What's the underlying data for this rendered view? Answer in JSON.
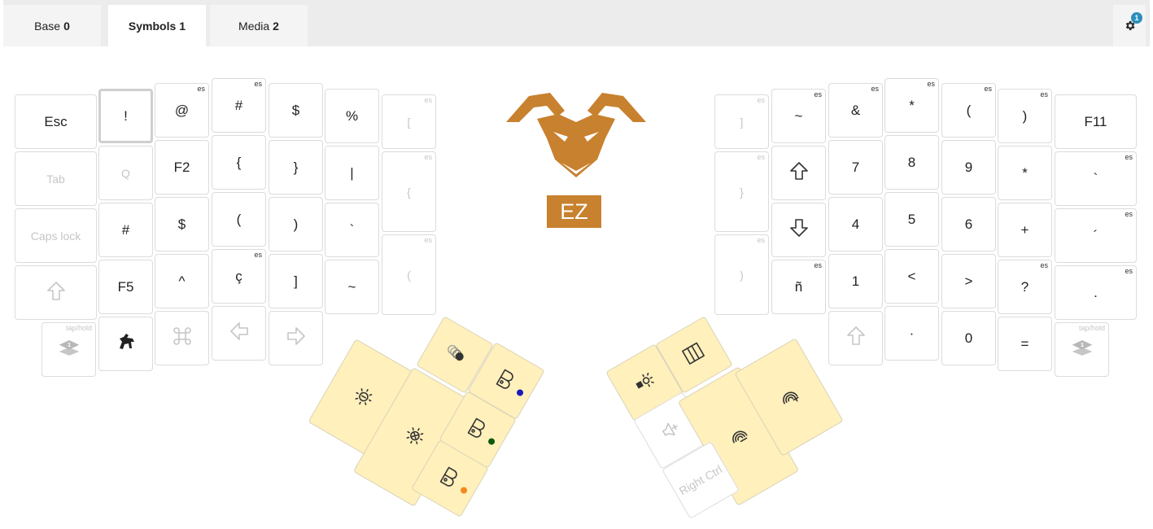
{
  "tabs": [
    {
      "label": "Base",
      "num": "0"
    },
    {
      "label": "Symbols",
      "num": "1"
    },
    {
      "label": "Media",
      "num": "2"
    }
  ],
  "settings": {
    "badge": "1",
    "icon": "gear-icon"
  },
  "logo": {
    "text": "EZ",
    "color": "#c8812e"
  },
  "tag_text": "es",
  "taphold_text": "tap/hold",
  "left_hand": {
    "col0": [
      "Esc",
      "Tab",
      "Caps lock",
      "shift-outline-icon",
      "layer-1-icon"
    ],
    "col1": [
      "!",
      "Q",
      "#",
      "F5",
      "goat-icon"
    ],
    "col2": [
      "@",
      "F2",
      "$",
      "^",
      "command-icon"
    ],
    "col3": [
      "#",
      "{",
      "(",
      "ç",
      "arrow-left-icon"
    ],
    "col4": [
      "$",
      "}",
      ")",
      "]",
      "arrow-right-icon"
    ],
    "col5": [
      "%",
      "|",
      "`",
      "~"
    ],
    "col6": [
      "[",
      "{",
      "("
    ]
  },
  "right_hand": {
    "col0": [
      "]",
      "}",
      ")"
    ],
    "col1": [
      "~",
      "arrow-up-icon",
      "arrow-down-icon",
      "ñ"
    ],
    "col2": [
      "&",
      "7",
      "4",
      "1",
      "shift-outline-icon"
    ],
    "col3": [
      "*",
      "8",
      "5",
      "<",
      "·"
    ],
    "col4": [
      "(",
      "9",
      "6",
      ">",
      "0"
    ],
    "col5": [
      ")",
      "*",
      "+",
      "?",
      "="
    ],
    "col6": [
      "F11",
      "`",
      "´",
      ".",
      "layer-1-icon"
    ]
  },
  "left_thumb": [
    "brightness-down-icon",
    "brightness-up-icon",
    "macro-icon",
    "bluetooth-profile-icon",
    "bluetooth-profile-icon",
    "bluetooth-profile-icon"
  ],
  "right_thumb": [
    "spotlight-icon",
    "panel-icon",
    "volume-up-icon",
    "rgb-down-icon",
    "rgb-up-icon",
    "Right Ctrl"
  ],
  "profile_dot_colors": [
    "#1a1ab8",
    "#0d5a0d",
    "#f08a1c"
  ]
}
